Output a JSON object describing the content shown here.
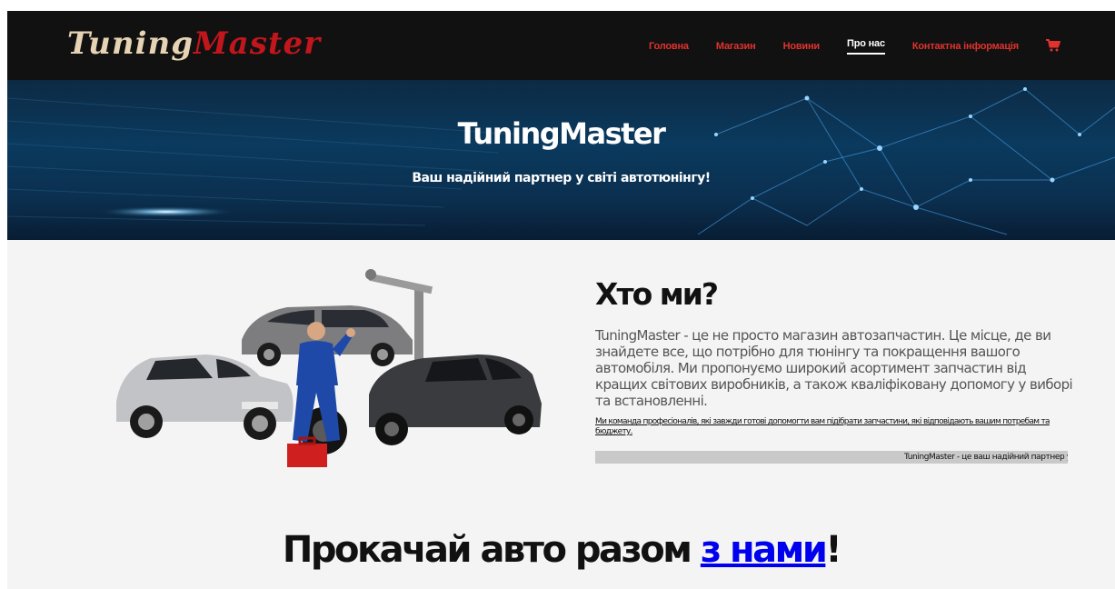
{
  "logo": {
    "part1": "Tuning",
    "part2": "Master"
  },
  "nav": {
    "items": [
      {
        "label": "Головна"
      },
      {
        "label": "Магазин"
      },
      {
        "label": "Новини"
      },
      {
        "label": "Про нас"
      },
      {
        "label": "Контактна інформація"
      }
    ],
    "active_index": 3,
    "cart_icon": "cart-icon"
  },
  "hero": {
    "title": "TuningMaster",
    "subtitle": "Ваш надійний партнер у світі автотюнінгу!"
  },
  "about": {
    "image_icon": "mechanic-with-cars-image",
    "title": "Хто ми?",
    "text": "TuningMaster - це не просто магазин автозапчастин. Це місце, де ви знайдете все, що потрібно для тюнінгу та покращення вашого автомобіля. Ми пропонуємо широкий асортимент запчастин від кращих світових виробників, а також кваліфіковану допомогу у виборі та встановленні.",
    "small_text": "Ми команда професіоналів, які завжди готові допомогти вам підібрати запчастини, які відповідають вашим потребам та бюджету.",
    "marquee": "TuningMaster - це ваш надійний партнер у т"
  },
  "cta": {
    "prefix": "Прокачай авто разом ",
    "link": "з нами",
    "suffix": "!"
  },
  "colors": {
    "nav_bg": "#111111",
    "nav_link": "#e0332e",
    "logo_red": "#c0161c",
    "page_bg": "#f4f4f4",
    "link_blue": "#0000ee"
  }
}
